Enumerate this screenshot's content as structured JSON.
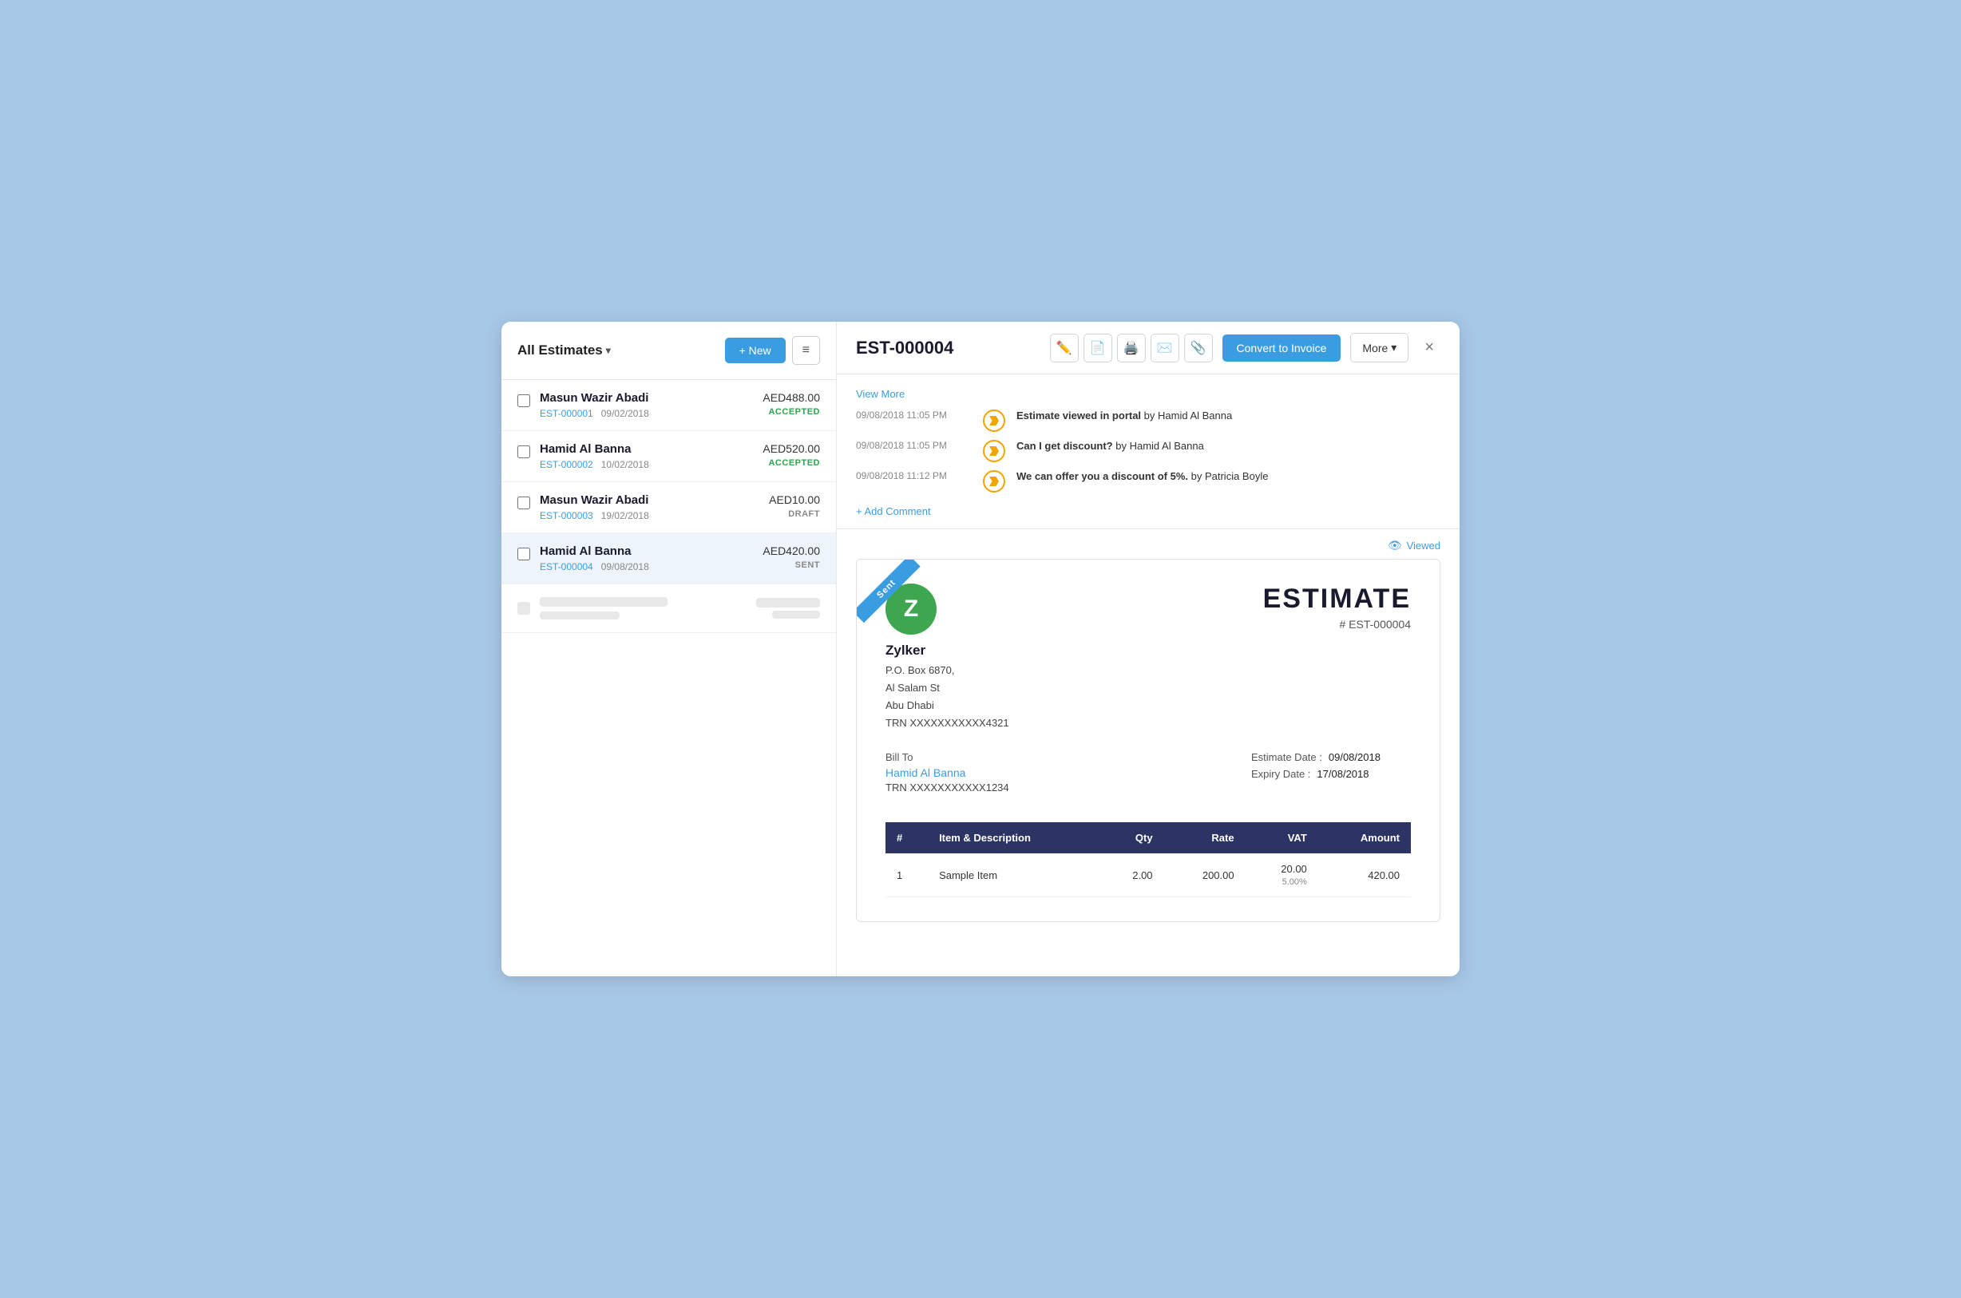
{
  "left_panel": {
    "title": "All Estimates",
    "btn_new": "+ New",
    "btn_hamburger": "≡",
    "list_items": [
      {
        "name": "Masun Wazir Abadi",
        "id": "EST-000001",
        "date": "09/02/2018",
        "amount": "AED488.00",
        "status": "ACCEPTED",
        "status_class": "status-accepted",
        "active": false
      },
      {
        "name": "Hamid Al Banna",
        "id": "EST-000002",
        "date": "10/02/2018",
        "amount": "AED520.00",
        "status": "ACCEPTED",
        "status_class": "status-accepted",
        "active": false
      },
      {
        "name": "Masun Wazir Abadi",
        "id": "EST-000003",
        "date": "19/02/2018",
        "amount": "AED10.00",
        "status": "DRAFT",
        "status_class": "status-draft",
        "active": false
      },
      {
        "name": "Hamid Al Banna",
        "id": "EST-000004",
        "date": "09/08/2018",
        "amount": "AED420.00",
        "status": "SENT",
        "status_class": "status-sent",
        "active": true
      }
    ]
  },
  "right_panel": {
    "estimate_id": "EST-000004",
    "btn_convert": "Convert to Invoice",
    "btn_more": "More",
    "btn_close": "×",
    "viewed_label": "Viewed",
    "view_more": "View More",
    "add_comment": "+ Add Comment",
    "activity": [
      {
        "time": "09/08/2018  11:05 PM",
        "text_bold": "Estimate viewed in portal",
        "text_normal": " by Hamid Al Banna"
      },
      {
        "time": "09/08/2018  11:05 PM",
        "text_bold": "Can I get discount?",
        "text_normal": " by Hamid Al Banna"
      },
      {
        "time": "09/08/2018  11:12 PM",
        "text_bold": "We can offer you a discount of 5%.",
        "text_normal": " by Patricia Boyle"
      }
    ],
    "document": {
      "sent_label": "Sent",
      "company_logo_letter": "Z",
      "company_name": "Zylker",
      "company_address_lines": [
        "P.O. Box 6870,",
        "Al Salam St",
        "Abu Dhabi",
        "TRN XXXXXXXXXXX4321"
      ],
      "doc_title": "ESTIMATE",
      "doc_number": "# EST-000004",
      "bill_to_label": "Bill To",
      "bill_to_name": "Hamid Al Banna",
      "bill_to_trn": "TRN XXXXXXXXXXX1234",
      "estimate_date_label": "Estimate Date :",
      "estimate_date": "09/08/2018",
      "expiry_date_label": "Expiry Date :",
      "expiry_date": "17/08/2018",
      "table_headers": [
        "#",
        "Item & Description",
        "Qty",
        "Rate",
        "VAT",
        "Amount"
      ],
      "table_rows": [
        {
          "num": "1",
          "description": "Sample Item",
          "qty": "2.00",
          "rate": "200.00",
          "vat": "20.00",
          "vat_sub": "5.00%",
          "amount": "420.00"
        }
      ]
    }
  }
}
